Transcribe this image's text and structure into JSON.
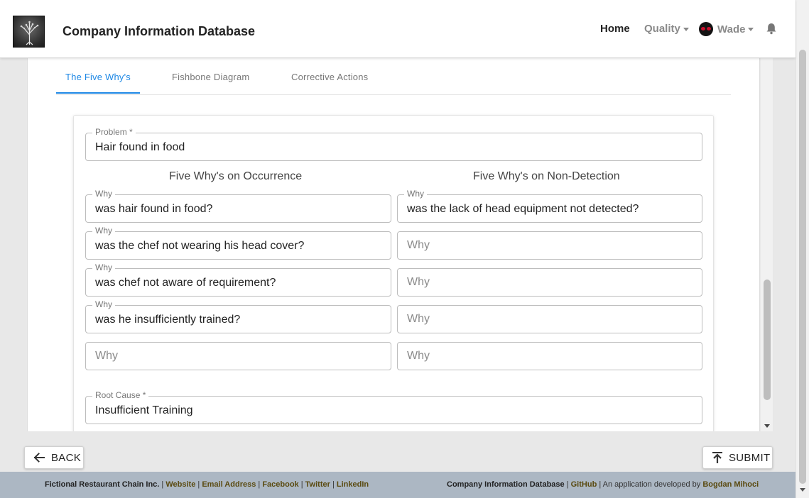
{
  "header": {
    "title": "Company Information Database",
    "nav": {
      "home": "Home",
      "quality": "Quality",
      "user": "Wade"
    }
  },
  "tabs": [
    {
      "label": "The Five Why's",
      "active": true
    },
    {
      "label": "Fishbone Diagram",
      "active": false
    },
    {
      "label": "Corrective Actions",
      "active": false
    }
  ],
  "form": {
    "problem": {
      "label": "Problem *",
      "value": "Hair found in food"
    },
    "occurrence": {
      "heading": "Five Why's on Occurrence",
      "whys": [
        {
          "label": "Why",
          "value": "was hair found in food?"
        },
        {
          "label": "Why",
          "value": "was the chef not wearing his head cover?"
        },
        {
          "label": "Why",
          "value": "was chef not aware of requirement?"
        },
        {
          "label": "Why",
          "value": "was he insufficiently trained?"
        },
        {
          "placeholder": "Why"
        }
      ]
    },
    "non_detection": {
      "heading": "Five Why's on Non-Detection",
      "whys": [
        {
          "label": "Why",
          "value": "was the lack of head equipment not detected?"
        },
        {
          "placeholder": "Why"
        },
        {
          "placeholder": "Why"
        },
        {
          "placeholder": "Why"
        },
        {
          "placeholder": "Why"
        }
      ]
    },
    "root_cause": {
      "label": "Root Cause *",
      "value": "Insufficient Training"
    }
  },
  "buttons": {
    "back": "BACK",
    "submit": "SUBMIT"
  },
  "footer": {
    "company": "Fictional Restaurant Chain Inc.",
    "links_left": [
      "Website",
      "Email Address",
      "Facebook",
      "Twitter",
      "LinkedIn"
    ],
    "app_name": "Company Information Database",
    "github": "GitHub",
    "developed_by": "An application developed by",
    "developer": "Bogdan Mihoci"
  },
  "colors": {
    "accent": "#1e88e5",
    "footer_bg": "#acb7c3",
    "footer_link": "#5a4a10"
  },
  "icons": {
    "logo": "tree-logo-icon",
    "bell": "bell-icon",
    "back": "arrow-left-icon",
    "submit": "upload-icon"
  }
}
